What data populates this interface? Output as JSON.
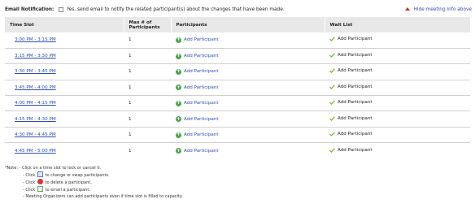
{
  "top": {
    "notif_label": "Email Notification:",
    "notif_text": "Yes, send email to notify the related participant(s) about the changes that have been made.",
    "hide_link": "Hide meeting info above"
  },
  "table": {
    "headers": [
      "Time Slot",
      "Max # of\nParticipants",
      "Participants",
      "Wait List"
    ],
    "rows": [
      {
        "slot": "3:00 PM - 3:15 PM",
        "max": "1",
        "participant": "Add Participant",
        "waitlist": "Add Participant"
      },
      {
        "slot": "3:15 PM - 3:30 PM",
        "max": "1",
        "participant": "Add Participant",
        "waitlist": "Add Participant"
      },
      {
        "slot": "3:30 PM - 3:45 PM",
        "max": "1",
        "participant": "Add Participant",
        "waitlist": "Add Participant"
      },
      {
        "slot": "3:45 PM - 4:00 PM",
        "max": "1",
        "participant": "Add Participant",
        "waitlist": "Add Participant"
      },
      {
        "slot": "4:00 PM - 4:15 PM",
        "max": "1",
        "participant": "Add Participant",
        "waitlist": "Add Participant"
      },
      {
        "slot": "4:15 PM - 4:30 PM",
        "max": "1",
        "participant": "Add Participant",
        "waitlist": "Add Participant"
      },
      {
        "slot": "4:30 PM - 4:45 PM",
        "max": "1",
        "participant": "Add Participant",
        "waitlist": "Add Participant"
      },
      {
        "slot": "4:45 PM - 5:00 PM",
        "max": "1",
        "participant": "Add Participant",
        "waitlist": "Add Participant"
      }
    ]
  },
  "notes": {
    "note_label": "*Note:",
    "line1": "- Click on a time slot to lock or cancel it.",
    "line2_pre": "- Click",
    "line2_post": "to change or swap participants.",
    "line3_pre": "- Click",
    "line3_post": "to delete a participant.",
    "line4_pre": "- Click",
    "line4_post": "to email a participant.",
    "line5": "- Meeting Organizers can add participants even if time slot is filled to capacity."
  },
  "colors": {
    "link": "#2a4fb0",
    "header_bg": "#e8e8e8",
    "plus_icon": "#4aa64a",
    "delete_icon": "#dd3333"
  },
  "icons": {
    "participant": "green-plus-icon",
    "waitlist": "waitlist-add-icon",
    "hide": "red-up-arrow-icon"
  }
}
